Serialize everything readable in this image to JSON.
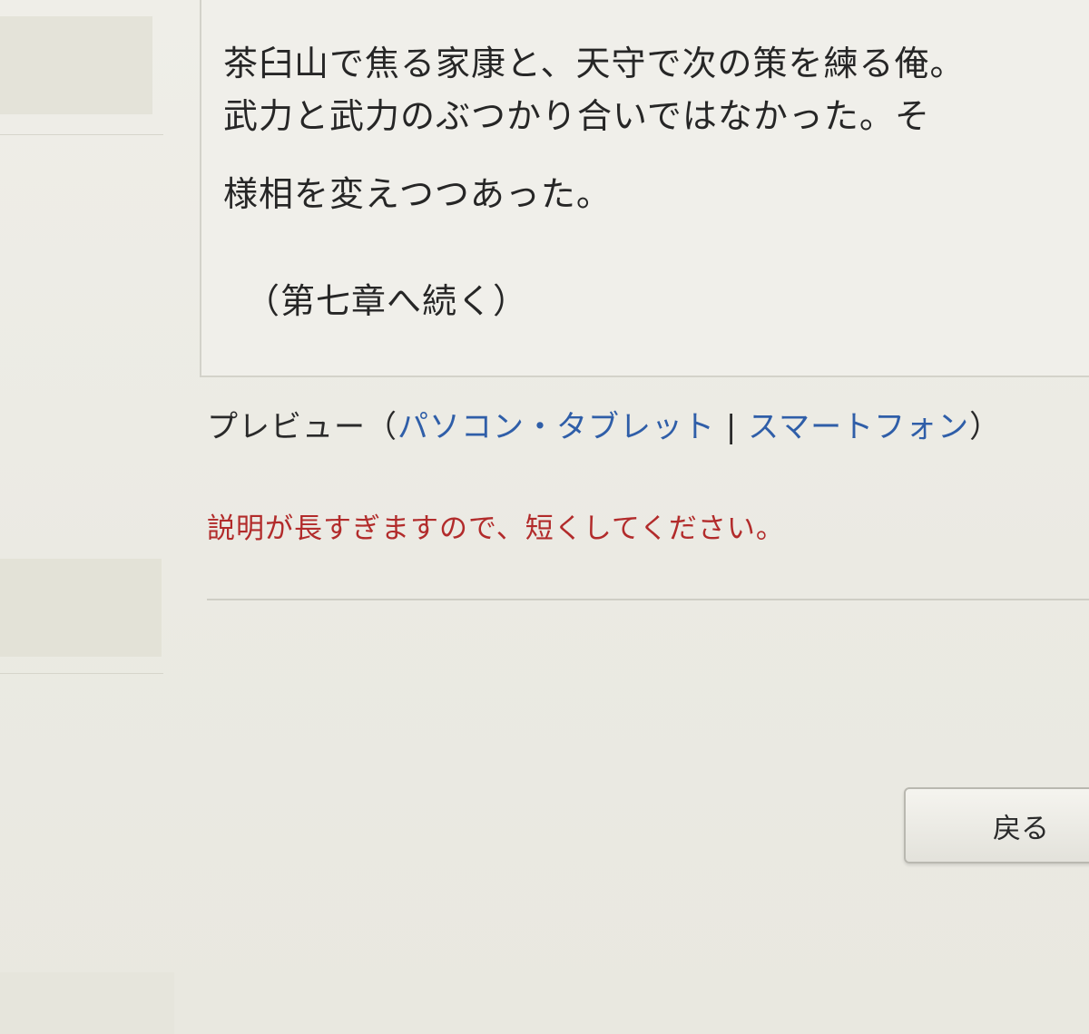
{
  "story": {
    "lines": [
      "茶臼山で焦る家康と、天守で次の策を練る俺。",
      "武力と武力のぶつかり合いではなかった。そ",
      "様相を変えつつあった。"
    ],
    "continuation": "（第七章へ続く）"
  },
  "preview": {
    "label": "プレビュー",
    "open_paren": "（",
    "pc_tablet_link": "パソコン・タブレット",
    "separator": "|",
    "smartphone_link": "スマートフォン",
    "close_paren": "）"
  },
  "error": {
    "message": "説明が長すぎますので、短くしてください。"
  },
  "actions": {
    "back_label": "戻る"
  },
  "colors": {
    "link": "#2f5ea8",
    "error": "#b22b2b"
  }
}
